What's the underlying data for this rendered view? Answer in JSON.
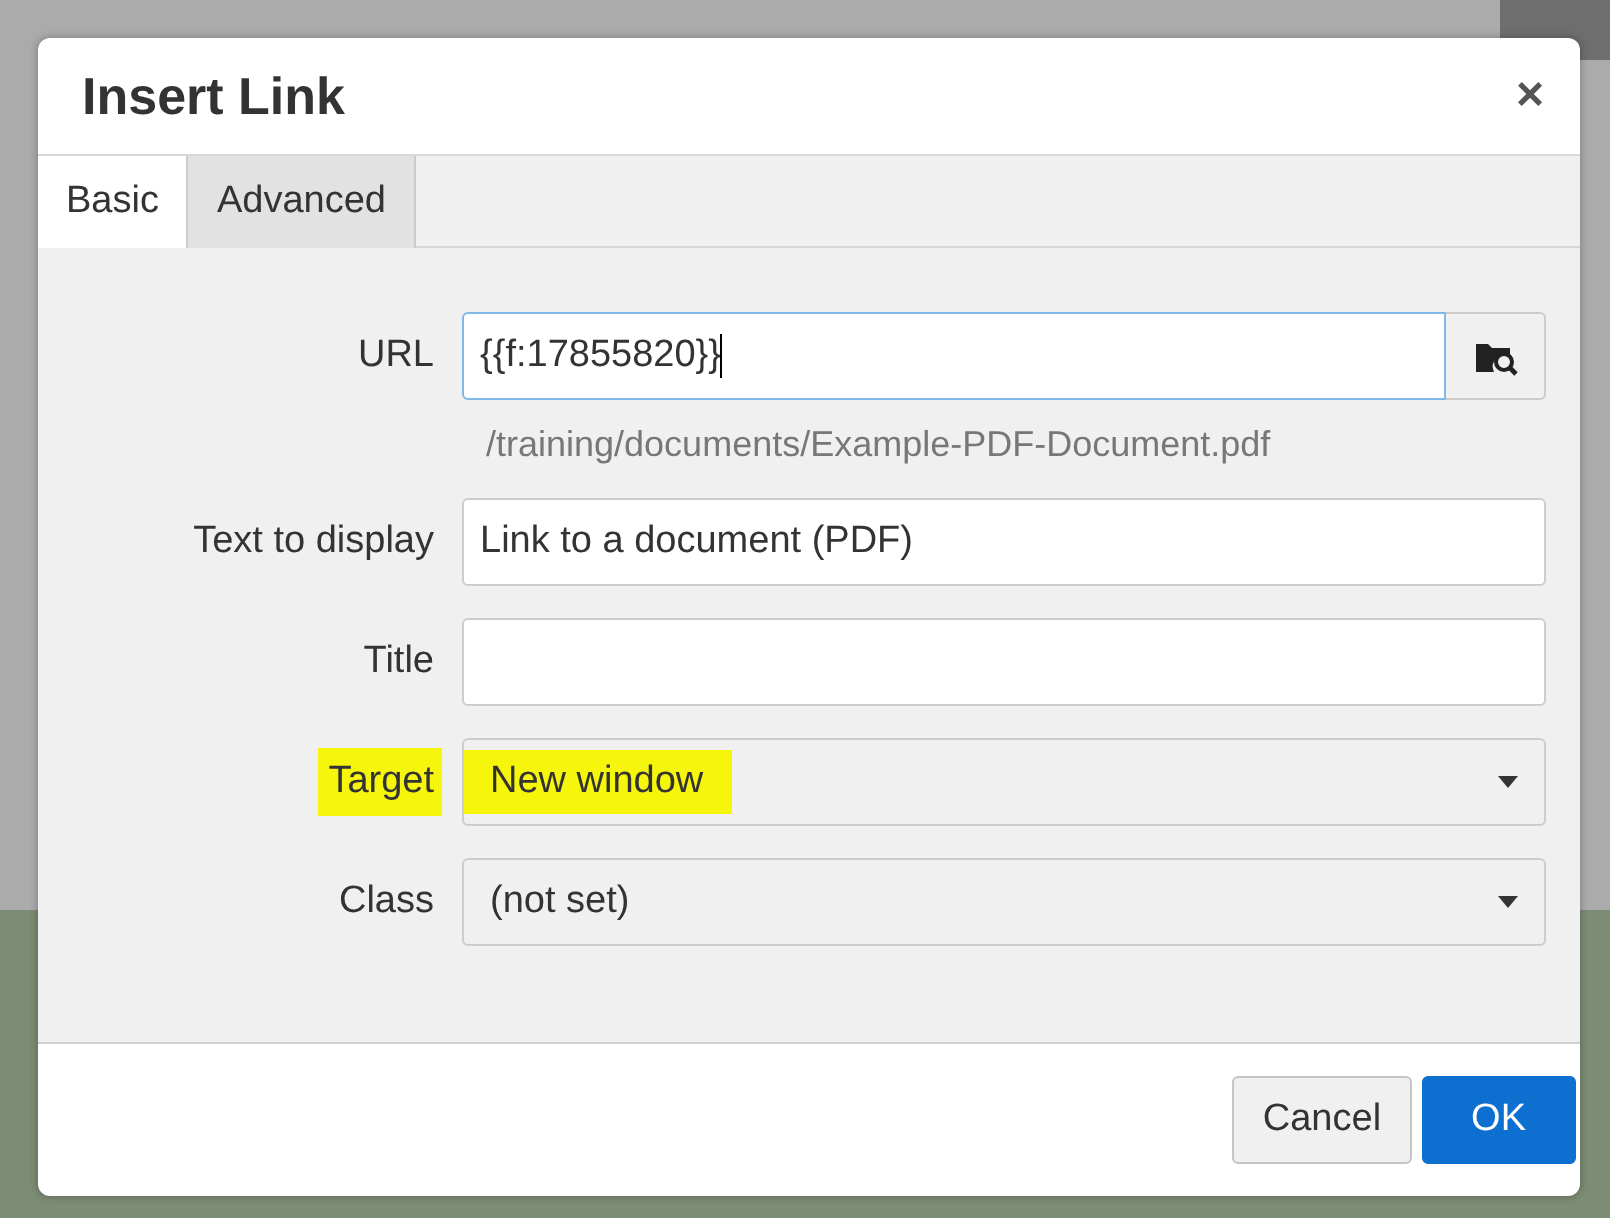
{
  "dialog": {
    "title": "Insert Link",
    "close": "×"
  },
  "tabs": [
    {
      "label": "Basic",
      "selected": true
    },
    {
      "label": "Advanced",
      "selected": false
    }
  ],
  "fields": [
    {
      "kind": "input",
      "label": "URL",
      "value": "{{f:17855820}}",
      "focused": true,
      "browse": true,
      "hint": "/training/documents/Example-PDF-Document.pdf",
      "highlighted": false
    },
    {
      "kind": "input",
      "label": "Text to display",
      "value": "Link to a document (PDF)",
      "highlighted": false
    },
    {
      "kind": "input",
      "label": "Title",
      "highlighted": false
    },
    {
      "kind": "select",
      "label": "Target",
      "value": "New window",
      "highlighted": true
    },
    {
      "kind": "select",
      "label": "Class",
      "value": "(not set)",
      "highlighted": false
    }
  ],
  "buttons": [
    {
      "label": "Cancel",
      "primary": false
    },
    {
      "label": "OK",
      "primary": true
    }
  ]
}
